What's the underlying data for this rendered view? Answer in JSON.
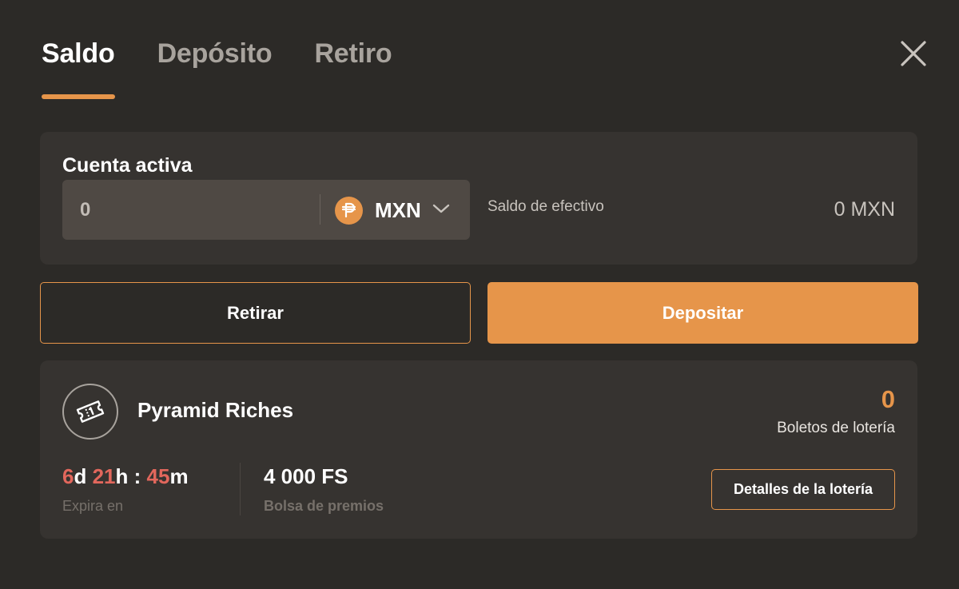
{
  "tabs": [
    {
      "label": "Saldo",
      "active": true
    },
    {
      "label": "Depósito",
      "active": false
    },
    {
      "label": "Retiro",
      "active": false
    }
  ],
  "account": {
    "title": "Cuenta activa",
    "amount": "0",
    "currency": "MXN",
    "currency_icon": "peso-icon",
    "cash_label": "Saldo de efectivo",
    "cash_value": "0 MXN"
  },
  "actions": {
    "withdraw_label": "Retirar",
    "deposit_label": "Depositar"
  },
  "lottery": {
    "name": "Pyramid Riches",
    "tickets_count": "0",
    "tickets_label": "Boletos de lotería",
    "timer": {
      "days": "6",
      "days_unit": "d",
      "hours": "21",
      "hours_unit": "h",
      "separator": ":",
      "minutes": "45",
      "minutes_unit": "m"
    },
    "expires_label": "Expira en",
    "prize_value": "4 000 FS",
    "prize_label": "Bolsa de premios",
    "details_label": "Detalles de la lotería"
  },
  "colors": {
    "background": "#2c2a27",
    "card": "#363330",
    "accent": "#e6954a",
    "timer_number": "#e2675c"
  }
}
